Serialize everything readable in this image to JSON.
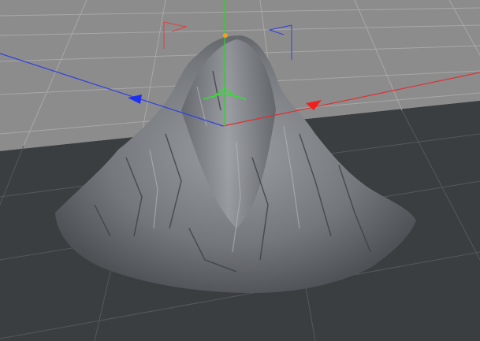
{
  "viewport": {
    "name": "3d-viewport",
    "colors": {
      "sky_plane": "#8c8c8c",
      "floor": "#3b3e41",
      "grid_light": "#a3a3a3",
      "grid_dark": "#55585b",
      "axis_x": "#e03030",
      "axis_y": "#30d030",
      "axis_z": "#3040e0",
      "mesh": "#7d8086",
      "handle": "#f0a020"
    },
    "icons": [
      "x-axis-handle-icon",
      "y-axis-handle-icon",
      "z-axis-handle-icon",
      "camera-flag-red-icon",
      "camera-flag-blue-icon"
    ]
  }
}
